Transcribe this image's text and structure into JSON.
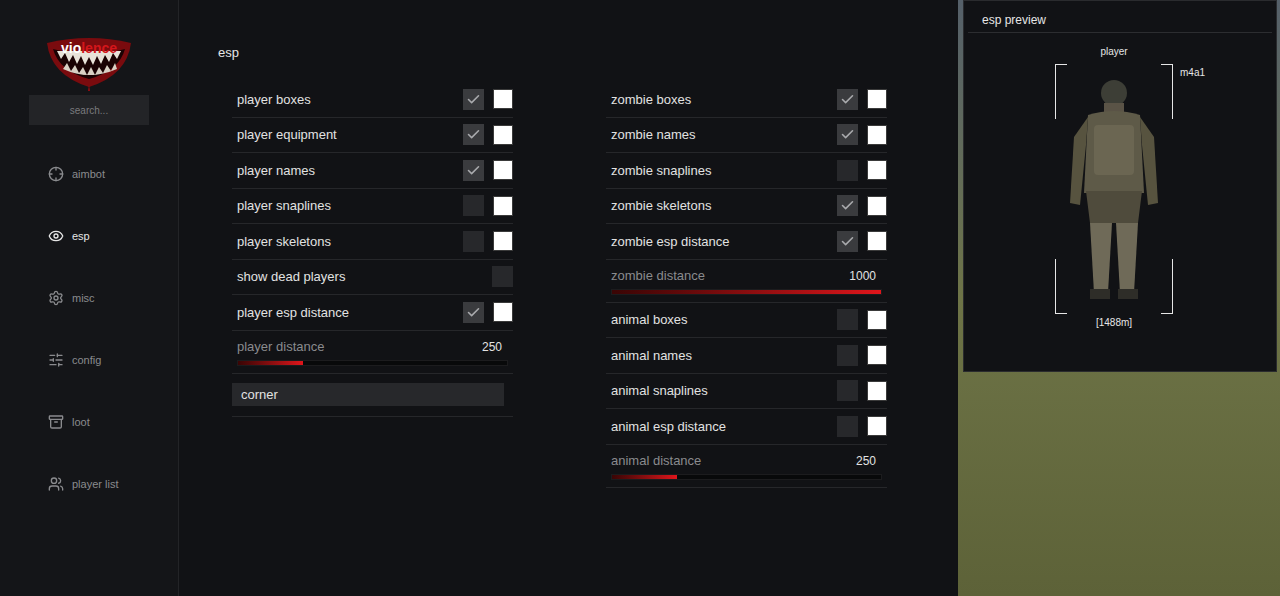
{
  "logo": {
    "parts": [
      {
        "text": "vio",
        "color": "#ffffff"
      },
      {
        "text": "lence",
        "color": "#d4161b"
      }
    ]
  },
  "search": {
    "placeholder": "search..."
  },
  "sidebar": {
    "items": [
      {
        "label": "aimbot",
        "icon": "crosshair",
        "selected": false
      },
      {
        "label": "esp",
        "icon": "eye",
        "selected": true
      },
      {
        "label": "misc",
        "icon": "gear",
        "selected": false
      },
      {
        "label": "config",
        "icon": "config",
        "selected": false
      },
      {
        "label": "loot",
        "icon": "box",
        "selected": false
      },
      {
        "label": "player list",
        "icon": "users",
        "selected": false
      }
    ]
  },
  "panel": {
    "title": "esp"
  },
  "columns": [
    [
      {
        "kind": "toggle",
        "label": "player boxes",
        "checked": true,
        "color": "#ffffff"
      },
      {
        "kind": "toggle",
        "label": "player equipment",
        "checked": true,
        "color": "#ffffff"
      },
      {
        "kind": "toggle",
        "label": "player names",
        "checked": true,
        "color": "#ffffff"
      },
      {
        "kind": "toggle",
        "label": "player snaplines",
        "checked": false,
        "color": "#ffffff"
      },
      {
        "kind": "toggle",
        "label": "player skeletons",
        "checked": false,
        "color": "#ffffff"
      },
      {
        "kind": "check",
        "label": "show dead players",
        "checked": false
      },
      {
        "kind": "toggle",
        "label": "player esp distance",
        "checked": true,
        "color": "#ffffff"
      },
      {
        "kind": "slider",
        "label": "player distance",
        "value": "250",
        "level": 0.24
      },
      {
        "kind": "dropdown",
        "value": "corner"
      }
    ],
    [
      {
        "kind": "toggle",
        "label": "zombie boxes",
        "checked": true,
        "color": "#ffffff"
      },
      {
        "kind": "toggle",
        "label": "zombie names",
        "checked": true,
        "color": "#ffffff"
      },
      {
        "kind": "toggle",
        "label": "zombie snaplines",
        "checked": false,
        "color": "#ffffff"
      },
      {
        "kind": "toggle",
        "label": "zombie skeletons",
        "checked": true,
        "color": "#ffffff"
      },
      {
        "kind": "toggle",
        "label": "zombie esp distance",
        "checked": true,
        "color": "#ffffff"
      },
      {
        "kind": "slider",
        "label": "zombie distance",
        "value": "1000",
        "level": 1.0
      },
      {
        "kind": "toggle",
        "label": "animal boxes",
        "checked": false,
        "color": "#ffffff"
      },
      {
        "kind": "toggle",
        "label": "animal names",
        "checked": false,
        "color": "#ffffff"
      },
      {
        "kind": "toggle",
        "label": "animal snaplines",
        "checked": false,
        "color": "#ffffff"
      },
      {
        "kind": "toggle",
        "label": "animal esp distance",
        "checked": false,
        "color": "#ffffff"
      },
      {
        "kind": "slider",
        "label": "animal distance",
        "value": "250",
        "level": 0.24
      }
    ]
  ],
  "preview": {
    "title": "esp preview",
    "name": "player",
    "weapon": "m4a1",
    "distance": "[1488m]"
  }
}
